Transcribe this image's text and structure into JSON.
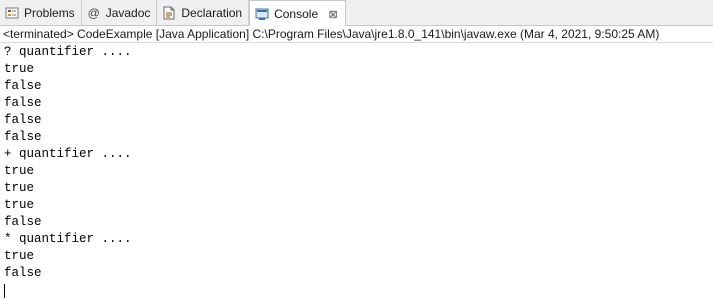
{
  "tabs": [
    {
      "label": "Problems",
      "icon": "problems-icon"
    },
    {
      "label": "Javadoc",
      "icon": "javadoc-at-icon",
      "glyph": "@"
    },
    {
      "label": "Declaration",
      "icon": "declaration-icon"
    },
    {
      "label": "Console",
      "icon": "console-icon",
      "active": true,
      "close": "⊠"
    }
  ],
  "status": "<terminated> CodeExample [Java Application] C:\\Program Files\\Java\\jre1.8.0_141\\bin\\javaw.exe (Mar 4, 2021, 9:50:25 AM)",
  "console": {
    "lines": [
      "? quantifier ....",
      "true",
      "false",
      "false",
      "false",
      "false",
      "+ quantifier ....",
      "true",
      "true",
      "true",
      "false",
      "* quantifier ....",
      "true",
      "false"
    ]
  },
  "colors": {
    "tabbar_bg": "#f0f0f0",
    "console_text": "#000000",
    "problems_icon": "#c0392b",
    "console_icon": "#3c6ea5"
  }
}
